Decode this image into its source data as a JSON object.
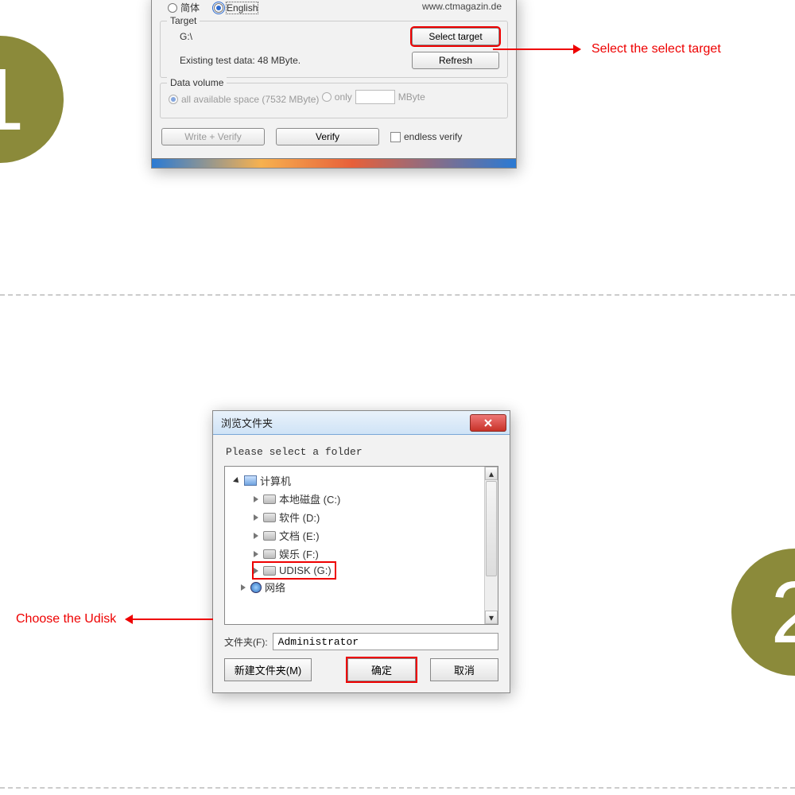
{
  "step1": {
    "circle": "1"
  },
  "step2": {
    "circle": "2"
  },
  "anno1": "Select the select target",
  "anno2": "Choose the Udisk",
  "dlg1": {
    "url": "www.ctmagazin.de",
    "langSimplified": "简体",
    "langEnglish": "English",
    "targetLabel": "Target",
    "targetPath": "G:\\",
    "selectTargetBtn": "Select target",
    "existingTest": "Existing test data: 48 MByte.",
    "refreshBtn": "Refresh",
    "dataVolumeLabel": "Data volume",
    "allSpace": "all available space (7532 MByte)",
    "onlyLabel": "only",
    "mbyteUnit": "MByte",
    "writeVerify": "Write + Verify",
    "verify": "Verify",
    "endless": "endless verify"
  },
  "dlg2": {
    "title": "浏览文件夹",
    "prompt": "Please select a folder",
    "tree": {
      "computer": "计算机",
      "c": "本地磁盘 (C:)",
      "d": "软件 (D:)",
      "e": "文档 (E:)",
      "f": "娱乐 (F:)",
      "g": "UDISK (G:)",
      "network": "网络"
    },
    "folderLabel": "文件夹(F):",
    "folderValue": "Administrator",
    "newFolder": "新建文件夹(M)",
    "ok": "确定",
    "cancel": "取消"
  }
}
